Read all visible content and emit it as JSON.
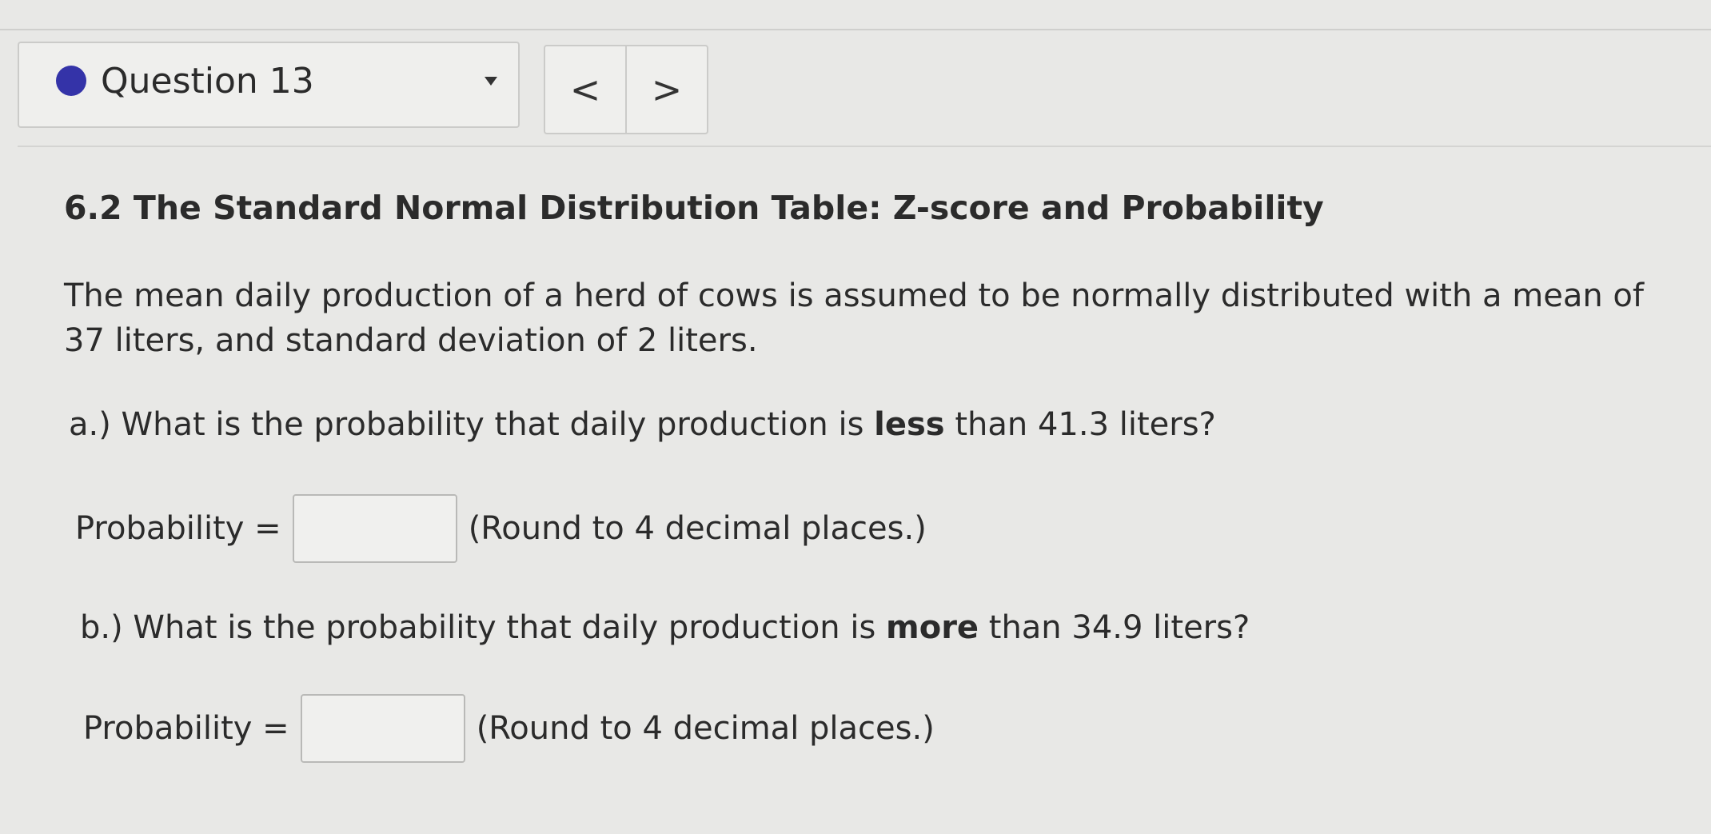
{
  "question_nav": {
    "label": "Question 13",
    "status_color": "#3433a8",
    "prev_symbol": "<",
    "next_symbol": ">"
  },
  "section": {
    "title": "6.2 The Standard Normal Distribution Table: Z-score and Probability"
  },
  "problem": {
    "intro": "The mean daily production of a herd of cows is assumed to be normally distributed with a mean of 37 liters, and standard deviation of 2 liters."
  },
  "part_a": {
    "prefix": "a.) What is the probability that daily production is ",
    "emphasis": "less",
    "suffix": " than 41.3 liters?",
    "answer_label": "Probability =",
    "answer_value": "",
    "round_note": "(Round to 4 decimal places.)"
  },
  "part_b": {
    "prefix": "b.) What is the probability that daily production is ",
    "emphasis": "more",
    "suffix": " than 34.9 liters?",
    "answer_label": "Probability =",
    "answer_value": "",
    "round_note": "(Round to 4 decimal places.)"
  }
}
